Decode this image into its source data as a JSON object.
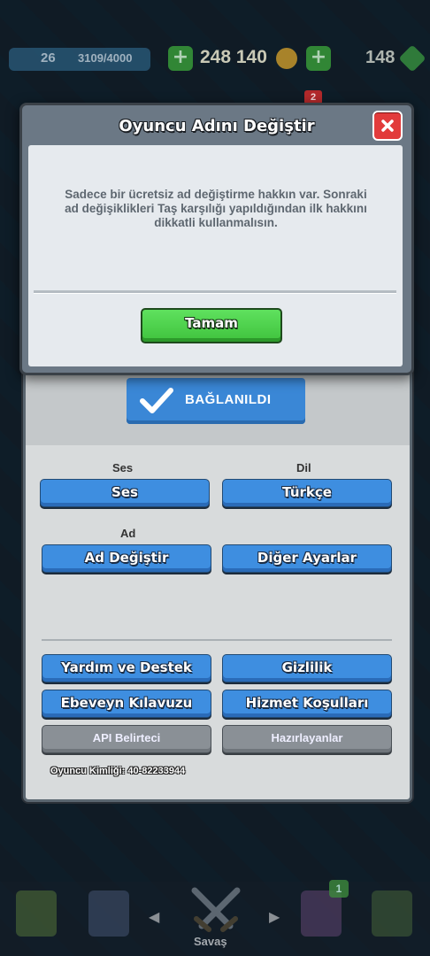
{
  "topbar": {
    "level": "26",
    "xp": "3109/4000",
    "gold": "248 140",
    "gems": "148",
    "notification_count": "2"
  },
  "dialog": {
    "title": "Oyuncu Adını Değiştir",
    "message": "Sadece bir ücretsiz ad değiştirme hakkın var. Sonraki ad değişiklikleri Taş karşılığı yapıldığından ilk hakkını dikkatli kullanmalısın.",
    "ok_label": "Tamam"
  },
  "settings": {
    "connected_label": "BAĞLANILDI",
    "sound_section": "Ses",
    "sound_button": "Ses",
    "language_section": "Dil",
    "language_button": "Türkçe",
    "name_section": "Ad",
    "change_name_button": "Ad Değiştir",
    "other_settings_button": "Diğer Ayarlar",
    "help_button": "Yardım ve Destek",
    "privacy_button": "Gizlilik",
    "parents_guide_button": "Ebeveyn Kılavuzu",
    "terms_button": "Hizmet Koşulları",
    "api_button": "API Belirteci",
    "credits_button": "Hazırlayanlar",
    "player_id": "Oyuncu Kimliği: 40-82233944"
  },
  "bottom_nav": {
    "battle_label": "Savaş",
    "badge_count": "1"
  },
  "colors": {
    "accent_blue": "#3e8ee0",
    "ok_green": "#4fd24d",
    "close_red": "#e23b3b"
  }
}
